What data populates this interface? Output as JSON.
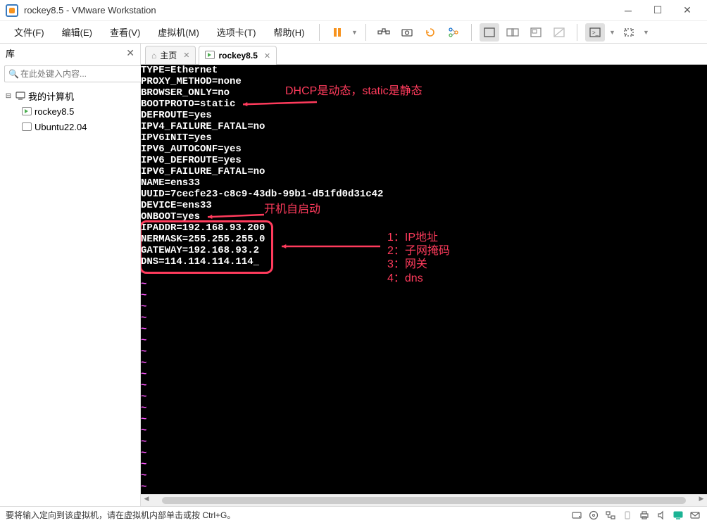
{
  "window": {
    "title": "rockey8.5 - VMware Workstation"
  },
  "menu": {
    "file": "文件(F)",
    "edit": "编辑(E)",
    "view": "查看(V)",
    "vm": "虚拟机(M)",
    "tabs": "选项卡(T)",
    "help": "帮助(H)"
  },
  "sidebar": {
    "title": "库",
    "search_placeholder": "在此处键入内容...",
    "root": "我的计算机",
    "items": [
      "rockey8.5",
      "Ubuntu22.04"
    ]
  },
  "tabs": {
    "home": "主页",
    "vm": "rockey8.5"
  },
  "console_lines": [
    "TYPE=Ethernet",
    "PROXY_METHOD=none",
    "BROWSER_ONLY=no",
    "BOOTPROTO=static",
    "DEFROUTE=yes",
    "IPV4_FAILURE_FATAL=no",
    "IPV6INIT=yes",
    "IPV6_AUTOCONF=yes",
    "IPV6_DEFROUTE=yes",
    "IPV6_FAILURE_FATAL=no",
    "NAME=ens33",
    "UUID=7cecfe23-c8c9-43db-99b1-d51fd0d31c42",
    "DEVICE=ens33",
    "ONBOOT=yes",
    "IPADDR=192.168.93.200",
    "NERMASK=255.255.255.0",
    "GATEWAY=192.168.93.2",
    "DNS=114.114.114.114_"
  ],
  "annotations": {
    "a1": "DHCP是动态，static是静态",
    "a2": "开机自启动",
    "list1": "1：IP地址",
    "list2": "2：子网掩码",
    "list3": "3：网关",
    "list4": "4：dns"
  },
  "status": {
    "message": "要将输入定向到该虚拟机，请在虚拟机内部单击或按 Ctrl+G。"
  },
  "colors": {
    "terminal_text": "#ffffff",
    "terminal_bg": "#000000",
    "annotation": "#ff3b5c",
    "tilde": "#ff55ff",
    "pause": "#f7931e"
  }
}
